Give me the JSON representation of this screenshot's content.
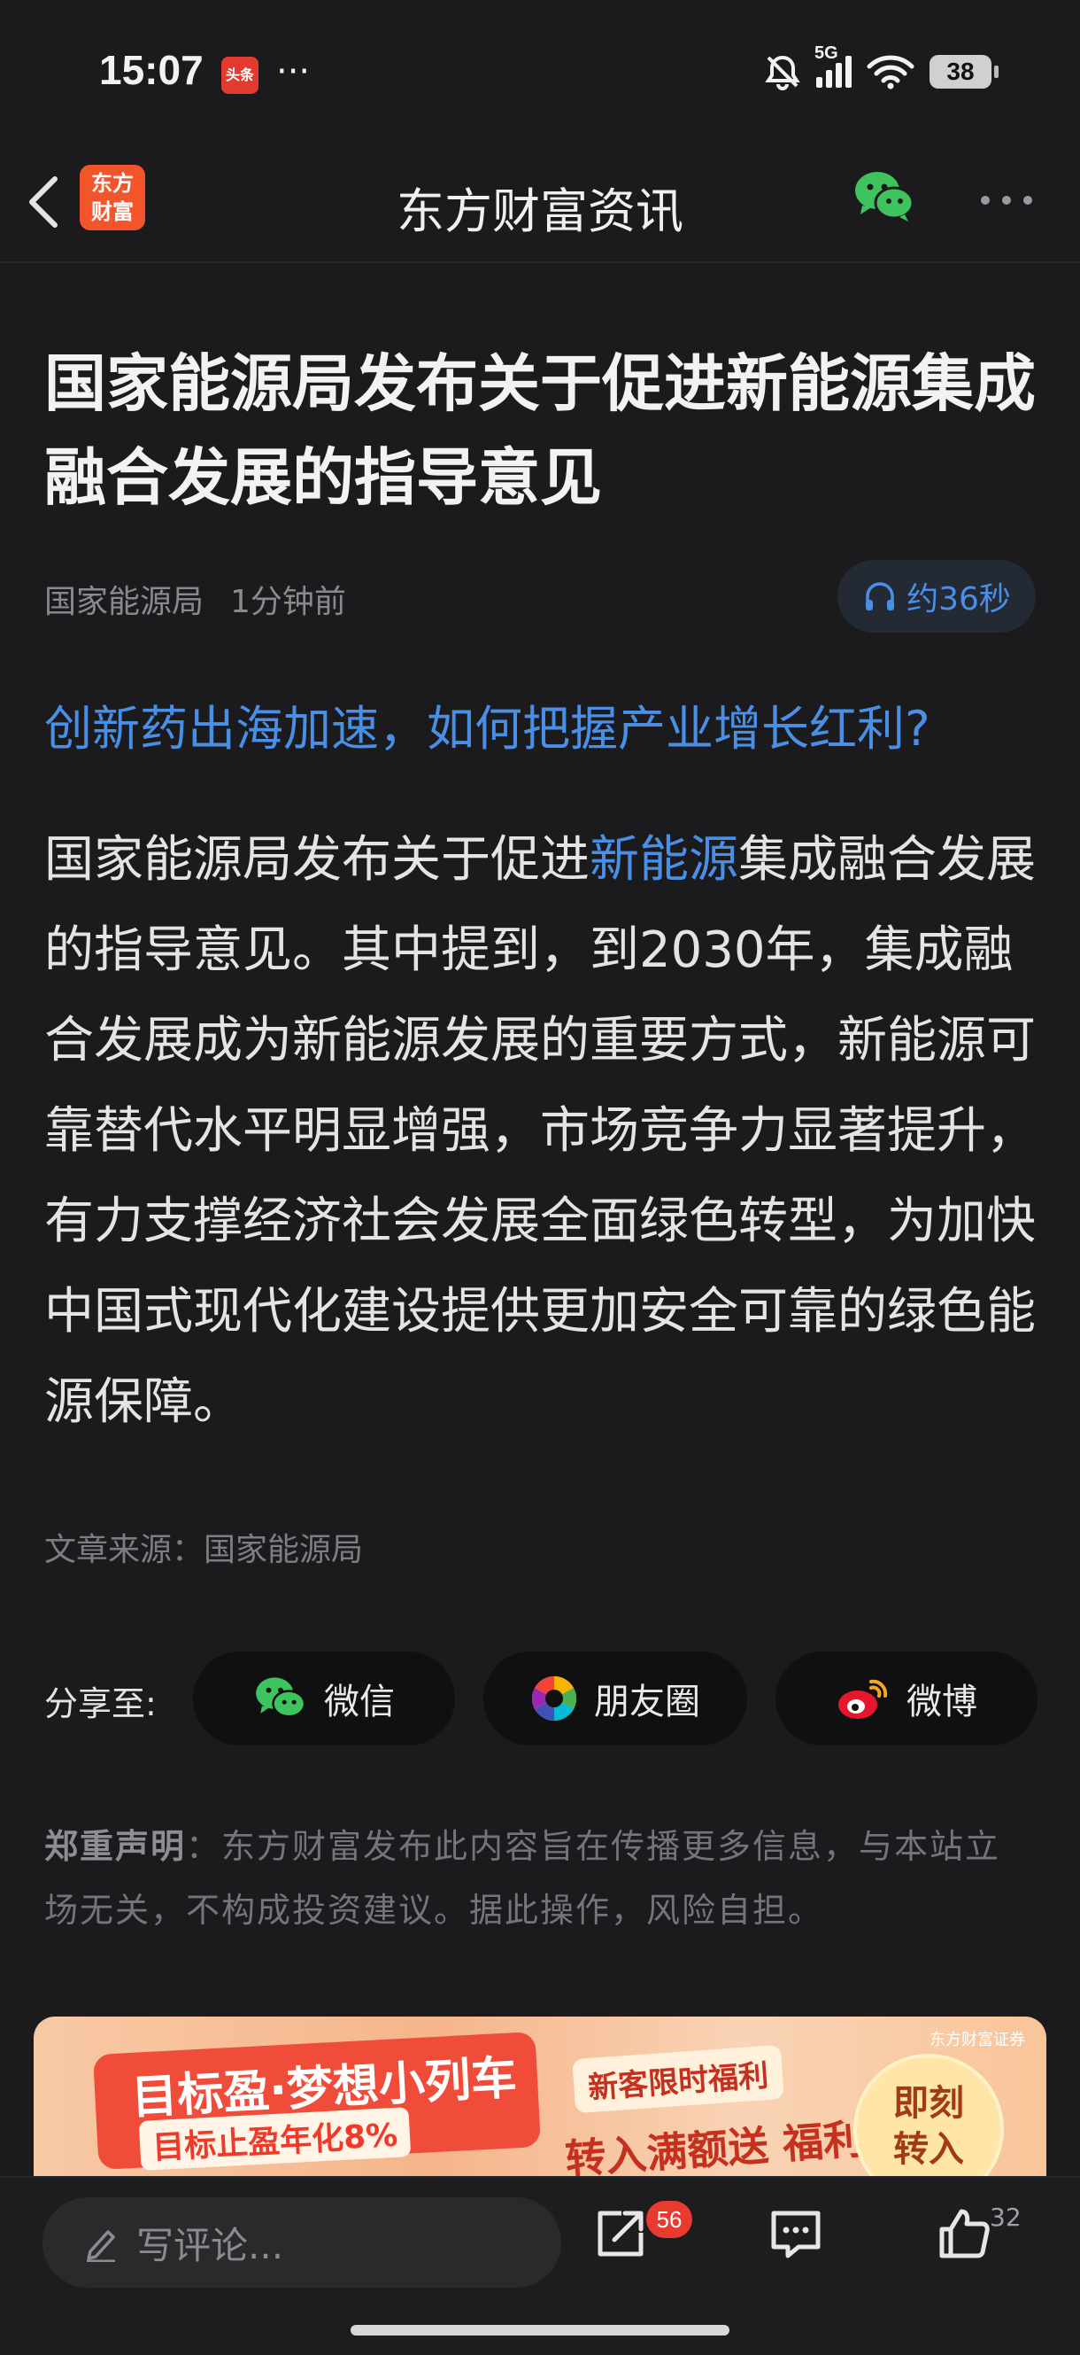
{
  "status_bar": {
    "time": "15:07",
    "toutiao_badge": "头条",
    "more": "···",
    "network": "5G",
    "battery": "38"
  },
  "navbar": {
    "logo_text_line1": "东方",
    "logo_text_line2": "财富",
    "title": "东方财富资讯"
  },
  "article": {
    "headline": "国家能源局发布关于促进新能源集成融合发展的指导意见",
    "source_name": "国家能源局",
    "time_ago": "1分钟前",
    "audio_duration": "约36秒",
    "promo_link": "创新药出海加速，如何把握产业增长红利?",
    "body_before": "国家能源局发布关于促进",
    "body_keyword": "新能源",
    "body_after": "集成融合发展的指导意见。其中提到，到2030年，集成融合发展成为新能源发展的重要方式，新能源可靠替代水平明显增强，市场竞争力显著提升，有力支撑经济社会发展全面绿色转型，为加快中国式现代化建设提供更加安全可靠的绿色能源保障。",
    "source_line": "文章来源：国家能源局"
  },
  "share": {
    "label": "分享至:",
    "wechat": "微信",
    "moments": "朋友圈",
    "weibo": "微博"
  },
  "disclaimer": {
    "title": "郑重声明",
    "text": "：东方财富发布此内容旨在传播更多信息，与本站立场无关，不构成投资建议。据此操作，风险自担。"
  },
  "banner": {
    "title": "目标盈·梦想小列车",
    "subtitle_prefix": "目标止盈年化",
    "subtitle_pct": "8%",
    "tag": "新客限时福利",
    "offer": "转入满额送 福利券",
    "cta_line1": "即刻",
    "cta_line2": "转入",
    "brand": "东方财富证券"
  },
  "bottom_bar": {
    "comment_placeholder": "写评论...",
    "share_count": "56",
    "like_count": "32"
  },
  "colors": {
    "background": "#1b1b1d",
    "accent_blue": "#4a8fe6",
    "badge_red": "#e93a2f",
    "logo_orange": "#f2552c"
  }
}
